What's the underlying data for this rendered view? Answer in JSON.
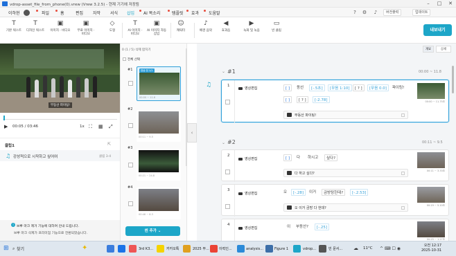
{
  "window": {
    "title": "vdrop-asset_file_from_phone(0).vrew (Vrew 3.2.5) - 현재 기기에 저장됨"
  },
  "menu": {
    "items": [
      "이하현",
      "파일",
      "홈",
      "편집",
      "자막",
      "서식",
      "삽입",
      "AI 목소리",
      "템플릿",
      "효과",
      "도움말"
    ],
    "active": "삽입",
    "right_buttons": [
      "버전출력",
      "업데이트"
    ]
  },
  "toolbar": {
    "tools": [
      {
        "label": "기본 텍스트",
        "icon": "T"
      },
      {
        "label": "디자인 텍스트",
        "icon": "T"
      },
      {
        "label": "이미지 · 비디오",
        "icon": "▣"
      },
      {
        "label": "무료 이미지 · 비디오",
        "icon": "▣"
      },
      {
        "label": "도형",
        "icon": "◇"
      },
      {
        "label": "AI 이미지 · 비디오",
        "icon": "T"
      },
      {
        "label": "AI 이미지 자동 삽입",
        "icon": "▣"
      },
      {
        "label": "캐릭터",
        "icon": "☺"
      },
      {
        "label": "배경 음악",
        "icon": "♪"
      },
      {
        "label": "효과음",
        "icon": "◀"
      },
      {
        "label": "녹화 및 녹음",
        "icon": "▶"
      },
      {
        "label": "빈 클립",
        "icon": "▭"
      }
    ],
    "export_label": "내보내기"
  },
  "player": {
    "subtitle": "부동산 파이팅!",
    "time": "00:05 / 03:46",
    "speed": "1x"
  },
  "clip_info": {
    "heading": "클립1",
    "text": "강성적으로 시작하고 싶어여",
    "count": "클립 3-4"
  },
  "notice": {
    "line1": "브루 마크 제거 기능에 대하여 안내 드립니다.",
    "line2": "브루 마크 삭제가 프리미엄 기능으로 전환되었습니다."
  },
  "thumbs": {
    "header": "0 (1 / 5)      삭제      합치기",
    "select_all": "전체 선택",
    "add_scene": "씬 추가",
    "items": [
      {
        "num": "#1",
        "time": "00:00 ~ 11.8",
        "tag": "영상 컷 1/1"
      },
      {
        "num": "#2",
        "time": "00:11 ~ 9.5",
        "tag": ""
      },
      {
        "num": "#3",
        "time": "00:21 ~ 24.8",
        "tag": ""
      },
      {
        "num": "#4",
        "time": "00:46 ~ 8.3",
        "tag": ""
      }
    ]
  },
  "editor": {
    "tabs": [
      "개요",
      "상세"
    ],
    "sections": [
      {
        "title": "#1",
        "time": "00:00 ~ 11.8"
      },
      {
        "title": "#2",
        "time": "00:11 ~ 9.5"
      }
    ],
    "clips": [
      {
        "num": "1",
        "label": "영상편집",
        "tokens": [
          "[ ]",
          "동선",
          "[-.5초]",
          "[무음 1:10]",
          "[ ? ]",
          "[무음 0.0]",
          "파이팅!",
          "[ ]",
          "[ ? ]",
          "[-2.78]"
        ],
        "subtitle": "부동산 파이팅!",
        "thumb_time": "00:00 ~ 11.75초"
      },
      {
        "num": "2",
        "label": "영상편집",
        "tokens": [
          "[ ]",
          "다",
          "하시고",
          "싶다?"
        ],
        "subtitle": "다 하고 싶다?",
        "thumb_time": "00:11 ~ 3.33초"
      },
      {
        "num": "3",
        "label": "영상편집",
        "tokens": [
          "오",
          "[-.28]",
          "이거",
          "금방탕헌데?",
          "[-.2.53]"
        ],
        "subtitle": "오 이거 금방 다 헌데?",
        "thumb_time": "00:19 ~ 5.10초"
      },
      {
        "num": "4",
        "label": "영상편집",
        "tokens": [
          "이",
          "부동산?",
          "[-.25]"
        ],
        "subtitle": "",
        "thumb_time": "00:25 ~ 1.27초"
      }
    ]
  },
  "taskbar": {
    "search": "찾기",
    "apps": [
      "3rd K3...",
      "카카오톡",
      "2025 부...",
      "이력인...",
      "analysis...",
      "Figure 1",
      "vdrop...",
      "빈 문서..."
    ],
    "temp": "11°C",
    "time": "오전 12:17",
    "date": "2025-10-31"
  }
}
